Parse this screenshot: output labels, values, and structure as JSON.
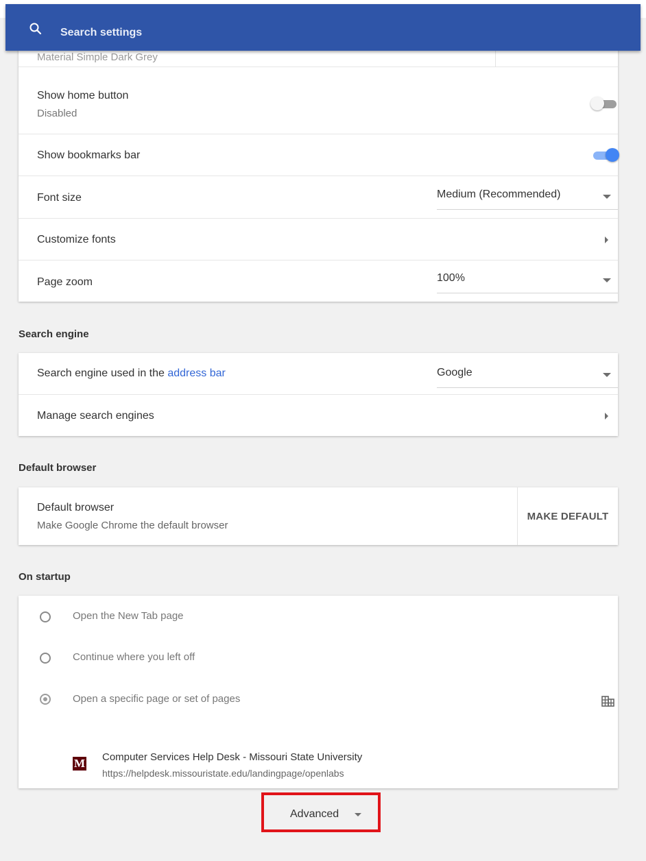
{
  "search": {
    "placeholder": "Search settings"
  },
  "appearance": {
    "partial_theme_text": "Material Simple Dark Grey",
    "show_home_button": {
      "label": "Show home button",
      "sub": "Disabled",
      "enabled": false
    },
    "show_bookmarks_bar": {
      "label": "Show bookmarks bar",
      "enabled": true
    },
    "font_size": {
      "label": "Font size",
      "value": "Medium (Recommended)"
    },
    "customize_fonts": {
      "label": "Customize fonts"
    },
    "page_zoom": {
      "label": "Page zoom",
      "value": "100%"
    }
  },
  "search_engine": {
    "heading": "Search engine",
    "used_label_prefix": "Search engine used in the ",
    "used_label_link": "address bar",
    "value": "Google",
    "manage_label": "Manage search engines"
  },
  "default_browser": {
    "heading": "Default browser",
    "title": "Default browser",
    "sub": "Make Google Chrome the default browser",
    "button": "MAKE DEFAULT"
  },
  "on_startup": {
    "heading": "On startup",
    "options": [
      {
        "label": "Open the New Tab page",
        "checked": false
      },
      {
        "label": "Continue where you left off",
        "checked": false
      },
      {
        "label": "Open a specific page or set of pages",
        "checked": true
      }
    ],
    "page": {
      "favicon_letter": "M",
      "title": "Computer Services Help Desk - Missouri State University",
      "url": "https://helpdesk.missouristate.edu/landingpage/openlabs"
    }
  },
  "advanced": {
    "label": "Advanced"
  },
  "colors": {
    "search_bar": "#2f55a8",
    "toggle_on_knob": "#4285f4",
    "toggle_on_track": "#8ab4f8",
    "toggle_off_knob": "#f5f5f5",
    "toggle_off_track": "#9e9e9e",
    "highlight_box": "#e1141a",
    "link": "#3367d6"
  }
}
